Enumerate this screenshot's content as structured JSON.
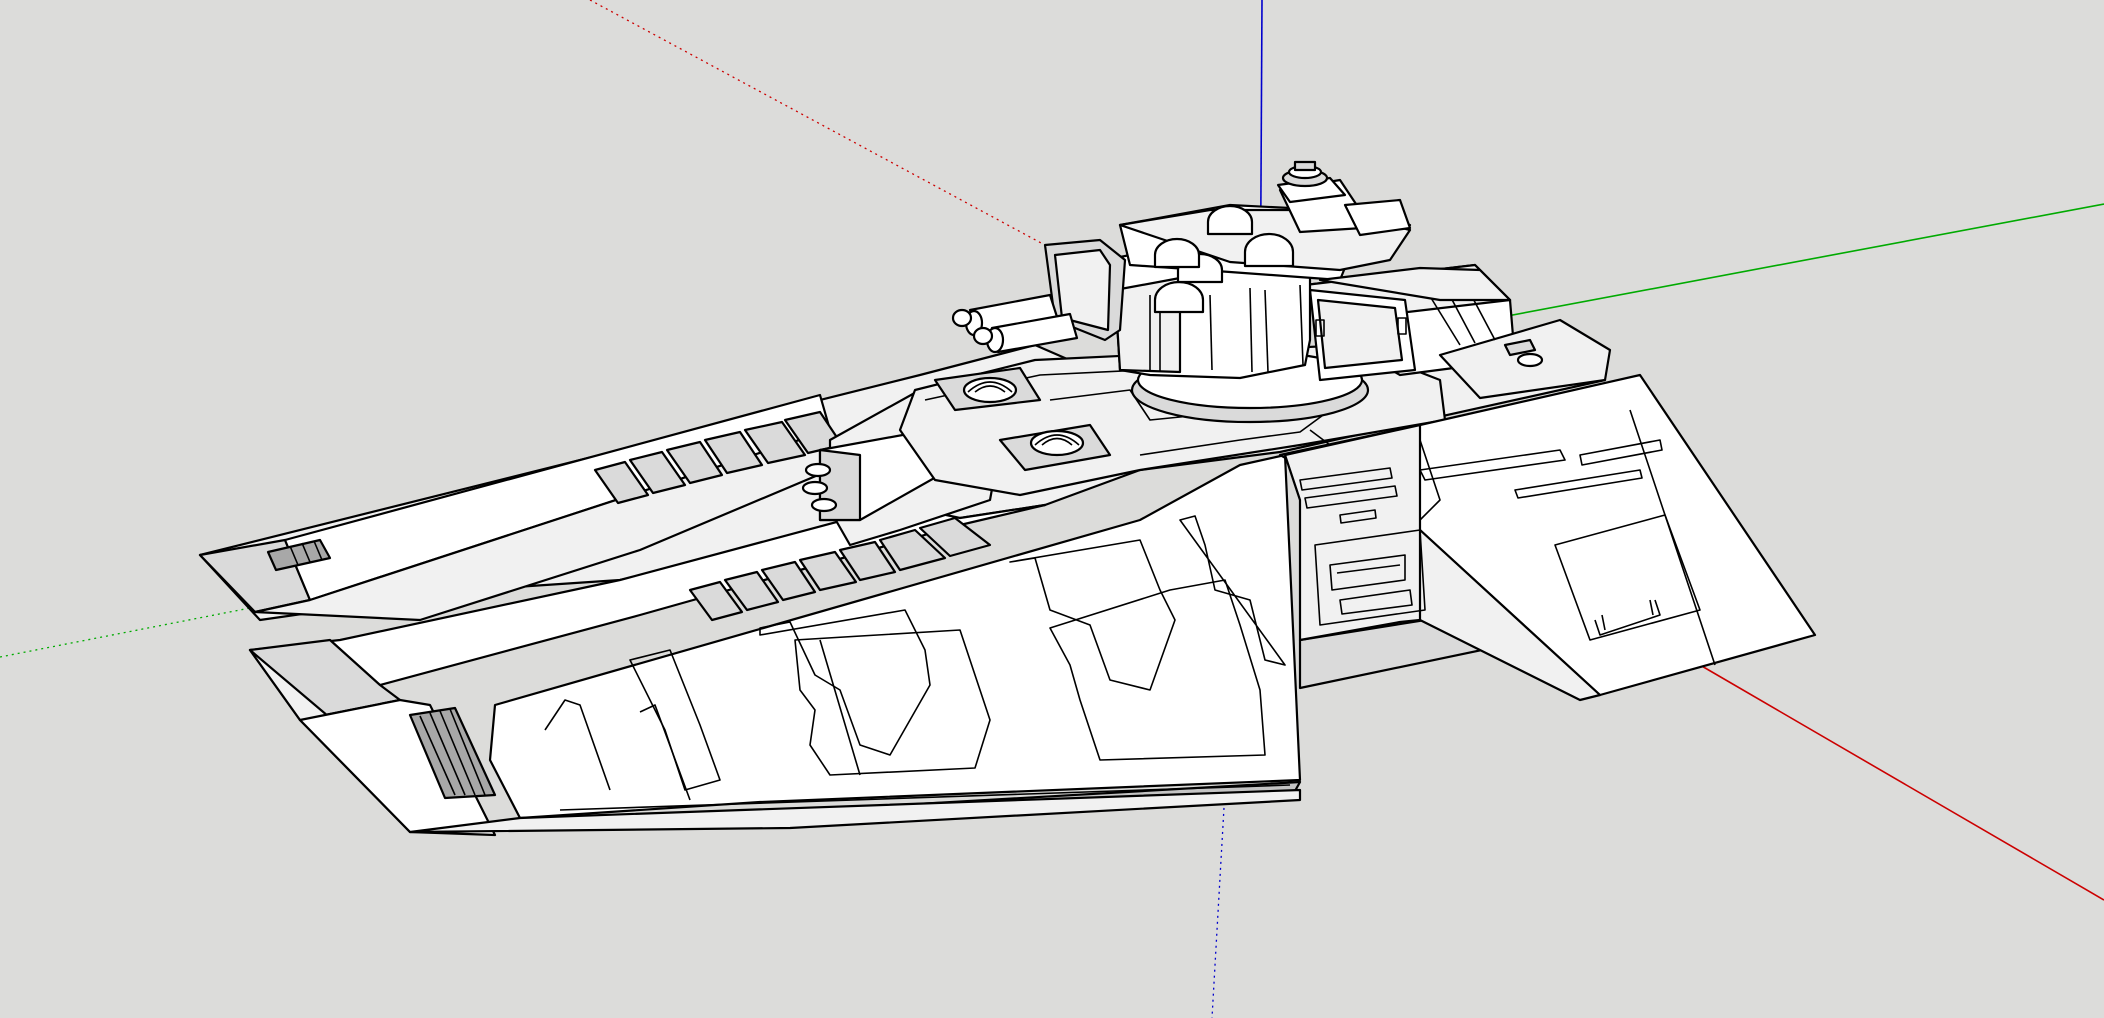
{
  "app": {
    "title": "",
    "tool": "orbit"
  },
  "viewport": {
    "background_color": "#dcdcda",
    "model": {
      "description_icon": "hover-tank-model",
      "fill_color": "#ffffff",
      "edge_color": "#000000"
    },
    "axes": {
      "red": "#cc0000",
      "green": "#00aa00",
      "blue": "#0000cc"
    }
  }
}
